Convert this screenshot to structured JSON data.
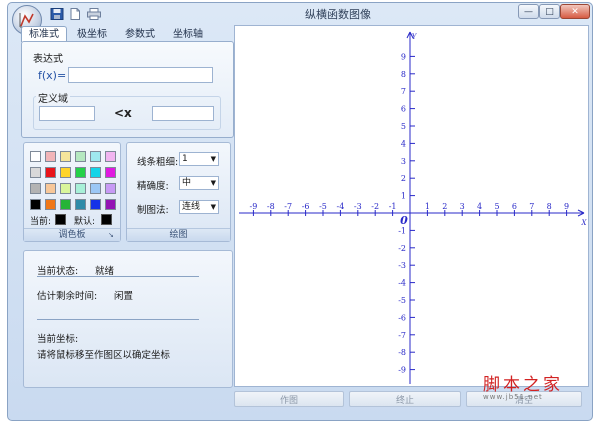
{
  "window": {
    "title": "纵横函数图像",
    "min_glyph": "—",
    "max_glyph": "□",
    "close_glyph": "✕"
  },
  "tabs": [
    {
      "label": "标准式",
      "active": true
    },
    {
      "label": "极坐标",
      "active": false
    },
    {
      "label": "参数式",
      "active": false
    },
    {
      "label": "坐标轴",
      "active": false
    }
  ],
  "expression": {
    "group_title": "表达式",
    "fx_label": "f(x)=",
    "value": "",
    "domain_title": "定义域",
    "domain_min": "",
    "domain_op": "<x",
    "domain_max": ""
  },
  "palette": {
    "colors": [
      "#ffffff",
      "#f2b5b8",
      "#f5e59b",
      "#b5e8c0",
      "#9fe8ee",
      "#f2b5f0",
      "#d9d9d9",
      "#e8141a",
      "#ffd42a",
      "#25d148",
      "#14d4e8",
      "#e01ae0",
      "#b3b3b3",
      "#f7c799",
      "#d9f59b",
      "#a8f0d8",
      "#9bc7f5",
      "#c89bf5",
      "#000000",
      "#f07818",
      "#25b436",
      "#2e8aa8",
      "#1432e8",
      "#9414b4"
    ],
    "current_label": "当前:",
    "default_label": "默认:",
    "current_color": "#000000",
    "default_color": "#000000",
    "caption": "调色板"
  },
  "draw": {
    "line_width_label": "线条粗细:",
    "line_width": "1",
    "precision_label": "精确度:",
    "precision": "中",
    "method_label": "制图法:",
    "method": "连线",
    "caption": "绘图"
  },
  "status": {
    "state_label": "当前状态:",
    "state_value": "就绪",
    "remaining_label": "估计剩余时间:",
    "remaining_value": "闲置",
    "coord_label": "当前坐标:",
    "coord_hint": "请将鼠标移至作图区以确定坐标"
  },
  "plot": {
    "x_axis_name": "X",
    "y_axis_name": "Y",
    "origin_label": "0",
    "x_ticks": [
      "-9",
      "-8",
      "-7",
      "-6",
      "-5",
      "-4",
      "-3",
      "-2",
      "-1",
      "1",
      "2",
      "3",
      "4",
      "5",
      "6",
      "7",
      "8",
      "9"
    ],
    "y_ticks": [
      "9",
      "8",
      "7",
      "6",
      "5",
      "4",
      "3",
      "2",
      "1",
      "-1",
      "-2",
      "-3",
      "-4",
      "-5",
      "-6",
      "-7",
      "-8",
      "-9"
    ],
    "axis_color": "#2929c8"
  },
  "buttons": {
    "plot": "作图",
    "stop": "终止",
    "clear": "清空"
  },
  "watermark": {
    "text": "脚本之家",
    "url": "www.jb51.net"
  }
}
